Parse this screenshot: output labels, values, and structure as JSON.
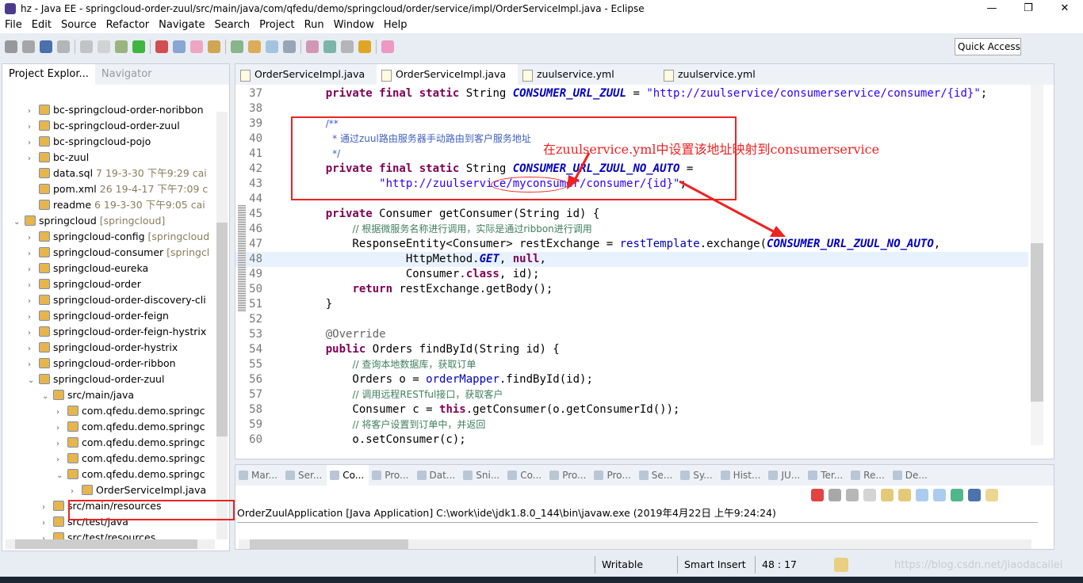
{
  "window": {
    "title": "hz - Java EE - springcloud-order-zuul/src/main/java/com/qfedu/demo/springcloud/order/service/impl/OrderServiceImpl.java - Eclipse",
    "minimize": "—",
    "maximize": "❐",
    "close": "✕"
  },
  "menu": [
    "File",
    "Edit",
    "Source",
    "Refactor",
    "Navigate",
    "Search",
    "Project",
    "Run",
    "Window",
    "Help"
  ],
  "toolbar": {
    "quick_access": "Quick Access"
  },
  "explorer": {
    "tabs": [
      "Project Explor...",
      "Navigator"
    ],
    "rows": [
      {
        "label": "bc-springcloud-order-noribbon",
        "extra": "",
        "indent": 2,
        "tw": "›"
      },
      {
        "label": "bc-springcloud-order-zuul",
        "extra": "",
        "indent": 2,
        "tw": "›"
      },
      {
        "label": "bc-springcloud-pojo",
        "extra": "",
        "indent": 2,
        "tw": "›"
      },
      {
        "label": "bc-zuul",
        "extra": "",
        "indent": 2,
        "tw": "›"
      },
      {
        "label": "data.sql",
        "extra": " 7  19-3-30 下午9:29  cai",
        "indent": 2,
        "tw": ""
      },
      {
        "label": "pom.xml",
        "extra": " 26  19-4-17 下午7:09  c",
        "indent": 2,
        "tw": ""
      },
      {
        "label": "readme",
        "extra": " 6  19-3-30 下午9:05  cai",
        "indent": 2,
        "tw": ""
      },
      {
        "label": "springcloud",
        "extra": " [springcloud]",
        "indent": 1,
        "tw": "⌄"
      },
      {
        "label": "springcloud-config",
        "extra": " [springcloud",
        "indent": 2,
        "tw": "›"
      },
      {
        "label": "springcloud-consumer",
        "extra": " [springcl",
        "indent": 2,
        "tw": "›"
      },
      {
        "label": "springcloud-eureka",
        "extra": "",
        "indent": 2,
        "tw": "›"
      },
      {
        "label": "springcloud-order",
        "extra": "",
        "indent": 2,
        "tw": "›"
      },
      {
        "label": "springcloud-order-discovery-cli",
        "extra": "",
        "indent": 2,
        "tw": "›"
      },
      {
        "label": "springcloud-order-feign",
        "extra": "",
        "indent": 2,
        "tw": "›"
      },
      {
        "label": "springcloud-order-feign-hystrix",
        "extra": "",
        "indent": 2,
        "tw": "›"
      },
      {
        "label": "springcloud-order-hystrix",
        "extra": "",
        "indent": 2,
        "tw": "›"
      },
      {
        "label": "springcloud-order-ribbon",
        "extra": "",
        "indent": 2,
        "tw": "›"
      },
      {
        "label": "springcloud-order-zuul",
        "extra": "",
        "indent": 2,
        "tw": "⌄"
      },
      {
        "label": "src/main/java",
        "extra": "",
        "indent": 3,
        "tw": "⌄"
      },
      {
        "label": "com.qfedu.demo.springc",
        "extra": "",
        "indent": 4,
        "tw": "›"
      },
      {
        "label": "com.qfedu.demo.springc",
        "extra": "",
        "indent": 4,
        "tw": "›"
      },
      {
        "label": "com.qfedu.demo.springc",
        "extra": "",
        "indent": 4,
        "tw": "›"
      },
      {
        "label": "com.qfedu.demo.springc",
        "extra": "",
        "indent": 4,
        "tw": "›"
      },
      {
        "label": "com.qfedu.demo.springc",
        "extra": "",
        "indent": 4,
        "tw": "⌄"
      },
      {
        "label": "OrderServiceImpl.java",
        "extra": "",
        "indent": 5,
        "tw": "›"
      },
      {
        "label": "src/main/resources",
        "extra": "",
        "indent": 3,
        "tw": "›"
      },
      {
        "label": "src/test/java",
        "extra": "",
        "indent": 3,
        "tw": "›"
      },
      {
        "label": "src/test/resources",
        "extra": "",
        "indent": 3,
        "tw": "›"
      }
    ]
  },
  "editor": {
    "tabs": [
      "OrderServiceImpl.java",
      "OrderServiceImpl.java",
      "zuulservice.yml",
      "zuulservice.yml"
    ],
    "active_tab": 1,
    "current_line": 48,
    "lines": [
      {
        "n": "37",
        "t": [
          [
            "",
            "    "
          ],
          [
            "kw",
            "private final static"
          ],
          [
            "",
            " String "
          ],
          [
            "cs",
            "CONSUMER_URL_ZUUL"
          ],
          [
            "",
            " = "
          ],
          [
            "st",
            "\"http://zuulservice/consumerservice/consumer/{id}\""
          ],
          [
            "",
            ";"
          ]
        ]
      },
      {
        "n": "38",
        "t": []
      },
      {
        "n": "39",
        "t": [
          [
            "",
            "    "
          ],
          [
            "cm",
            "/**"
          ]
        ]
      },
      {
        "n": "40",
        "t": [
          [
            "",
            "     "
          ],
          [
            "cm",
            "* 通过zuul路由服务器手动路由到客户服务地址"
          ]
        ]
      },
      {
        "n": "41",
        "t": [
          [
            "",
            "     "
          ],
          [
            "cm",
            "*/"
          ]
        ]
      },
      {
        "n": "42",
        "t": [
          [
            "",
            "    "
          ],
          [
            "kw",
            "private final static"
          ],
          [
            "",
            " String "
          ],
          [
            "cs",
            "CONSUMER_URL_ZUUL_NO_AUTO"
          ],
          [
            "",
            " ="
          ]
        ]
      },
      {
        "n": "43",
        "t": [
          [
            "",
            "            "
          ],
          [
            "st",
            "\"http://zuulservice/myconsumer/consumer/{id}\""
          ],
          [
            "",
            ";"
          ]
        ]
      },
      {
        "n": "44",
        "t": []
      },
      {
        "n": "45",
        "t": [
          [
            "",
            "    "
          ],
          [
            "kw",
            "private"
          ],
          [
            "",
            " Consumer getConsumer(String id) {"
          ]
        ]
      },
      {
        "n": "46",
        "t": [
          [
            "",
            "        "
          ],
          [
            "lc",
            "// 根据微服务名称进行调用，实际是通过ribbon进行调用"
          ]
        ]
      },
      {
        "n": "47",
        "t": [
          [
            "",
            "        ResponseEntity<Consumer> "
          ],
          [
            "",
            "restExchange = "
          ],
          [
            "fd",
            "restTemplate"
          ],
          [
            "",
            ".exchange("
          ],
          [
            "cs",
            "CONSUMER_URL_ZUUL_NO_AUTO"
          ],
          [
            "",
            ","
          ]
        ]
      },
      {
        "n": "48",
        "t": [
          [
            "",
            "                HttpMethod."
          ],
          [
            "cs",
            "GET"
          ],
          [
            "",
            ", "
          ],
          [
            "kw",
            "null"
          ],
          [
            "",
            ","
          ]
        ]
      },
      {
        "n": "49",
        "t": [
          [
            "",
            "                Consumer."
          ],
          [
            "kw",
            "class"
          ],
          [
            "",
            ", id);"
          ]
        ]
      },
      {
        "n": "50",
        "t": [
          [
            "",
            "        "
          ],
          [
            "kw",
            "return"
          ],
          [
            "",
            " restExchange.getBody();"
          ]
        ]
      },
      {
        "n": "51",
        "t": [
          [
            "",
            "    }"
          ]
        ]
      },
      {
        "n": "52",
        "t": []
      },
      {
        "n": "53",
        "t": [
          [
            "",
            "    "
          ],
          [
            "an",
            "@Override"
          ]
        ]
      },
      {
        "n": "54",
        "t": [
          [
            "",
            "    "
          ],
          [
            "kw",
            "public"
          ],
          [
            "",
            " Orders findById(String id) {"
          ]
        ]
      },
      {
        "n": "55",
        "t": [
          [
            "",
            "        "
          ],
          [
            "lc",
            "// 查询本地数据库，获取订单"
          ]
        ]
      },
      {
        "n": "56",
        "t": [
          [
            "",
            "        Orders o = "
          ],
          [
            "fd",
            "orderMapper"
          ],
          [
            "",
            ".findById(id);"
          ]
        ]
      },
      {
        "n": "57",
        "t": [
          [
            "",
            "        "
          ],
          [
            "lc",
            "// 调用远程RESTful接口，获取客户"
          ]
        ]
      },
      {
        "n": "58",
        "t": [
          [
            "",
            "        Consumer c = "
          ],
          [
            "kw",
            "this"
          ],
          [
            "",
            ".getConsumer(o.getConsumerId());"
          ]
        ]
      },
      {
        "n": "59",
        "t": [
          [
            "",
            "        "
          ],
          [
            "lc",
            "// 将客户设置到订单中，并返回"
          ]
        ]
      },
      {
        "n": "60",
        "t": [
          [
            "",
            "        o.setConsumer(c);"
          ]
        ]
      }
    ]
  },
  "annotation": {
    "text": "在zuulservice.yml中设置该地址映射到consumerservice",
    "color": "#ee2222"
  },
  "console": {
    "tabs": [
      "Mar...",
      "Ser...",
      "Co...",
      "Pro...",
      "Dat...",
      "Sni...",
      "Co...",
      "Pro...",
      "Pro...",
      "Se...",
      "Sy...",
      "Hist...",
      "JU...",
      "Ter...",
      "Re...",
      "De..."
    ],
    "active_tab": 2,
    "launch": "OrderZuulApplication [Java Application] C:\\work\\ide\\jdk1.8.0_144\\bin\\javaw.exe (2019年4月22日 上午9:24:24)"
  },
  "status": {
    "writable": "Writable",
    "insert_mode": "Smart Insert",
    "position": "48 : 17",
    "watermark": "https://blog.csdn.net/jiaodacailei"
  }
}
